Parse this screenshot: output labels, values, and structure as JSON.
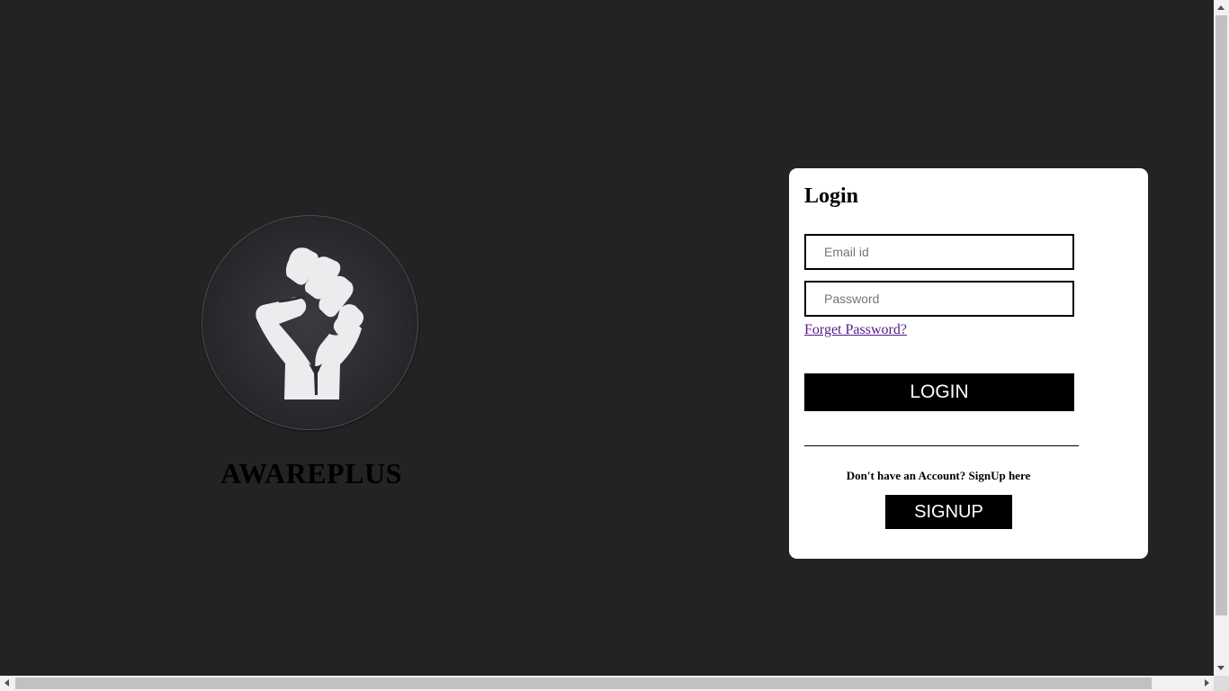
{
  "brand": {
    "name": "AWAREPLUS",
    "logo_icon": "raised-fist-icon"
  },
  "login_form": {
    "title": "Login",
    "email_placeholder": "Email id",
    "password_placeholder": "Password",
    "forget_password_label": "Forget Password?",
    "login_button_label": "LOGIN",
    "divider": "______________________________________",
    "signup_prompt": "Don't have an Account? SignUp here",
    "signup_button_label": "SIGNUP"
  },
  "colors": {
    "page_background": "#232323",
    "card_background": "#ffffff",
    "button_background": "#000000",
    "link_color": "#551a8b"
  }
}
